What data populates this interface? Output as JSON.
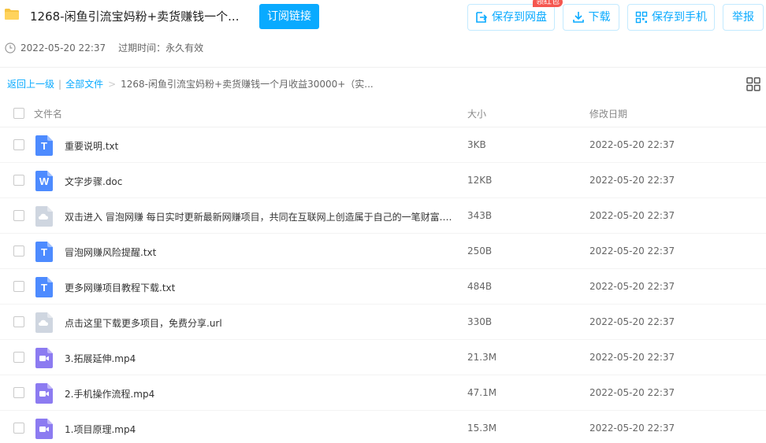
{
  "header": {
    "title": "1268-闲鱼引流宝妈粉+卖货赚钱一个...",
    "subscribe_label": "订阅链接",
    "created": "2022-05-20 22:37",
    "expire": "过期时间：永久有效",
    "folder_icon_color": "#f7c443"
  },
  "toolbar": {
    "save_pan_label": "保存到网盘",
    "badge_label": "领红包",
    "download_label": "下载",
    "save_phone_label": "保存到手机",
    "report_label": "举报",
    "accent_color": "#09aaff",
    "badge_color": "#f5564f"
  },
  "breadcrumb": {
    "back": "返回上一级",
    "all": "全部文件",
    "current": "1268-闲鱼引流宝妈粉+卖货赚钱一个月收益30000+（实..."
  },
  "columns": {
    "name": "文件名",
    "size": "大小",
    "date": "修改日期"
  },
  "files": [
    {
      "name": "重要说明.txt",
      "size": "3KB",
      "date": "2022-05-20 22:37",
      "icon": "txt-file-icon",
      "letter": "T",
      "color": "#4d8bff"
    },
    {
      "name": "文字步骤.doc",
      "size": "12KB",
      "date": "2022-05-20 22:37",
      "icon": "doc-file-icon",
      "letter": "W",
      "color": "#4d8bff"
    },
    {
      "name": "双击进入 冒泡网赚 每日实时更新最新网赚项目，共同在互联网上创造属于自己的一笔财富.url",
      "size": "343B",
      "date": "2022-05-20 22:37",
      "icon": "url-file-icon",
      "letter": "",
      "color": "#cfd6e0"
    },
    {
      "name": "冒泡网赚风险提醒.txt",
      "size": "250B",
      "date": "2022-05-20 22:37",
      "icon": "txt-file-icon",
      "letter": "T",
      "color": "#4d8bff"
    },
    {
      "name": "更多网赚项目教程下载.txt",
      "size": "484B",
      "date": "2022-05-20 22:37",
      "icon": "txt-file-icon",
      "letter": "T",
      "color": "#4d8bff"
    },
    {
      "name": "点击这里下载更多项目，免费分享.url",
      "size": "330B",
      "date": "2022-05-20 22:37",
      "icon": "url-file-icon",
      "letter": "",
      "color": "#cfd6e0"
    },
    {
      "name": "3.拓展延伸.mp4",
      "size": "21.3M",
      "date": "2022-05-20 22:37",
      "icon": "video-file-icon",
      "letter": "",
      "color": "#8c7bf1"
    },
    {
      "name": "2.手机操作流程.mp4",
      "size": "47.1M",
      "date": "2022-05-20 22:37",
      "icon": "video-file-icon",
      "letter": "",
      "color": "#8c7bf1"
    },
    {
      "name": "1.项目原理.mp4",
      "size": "15.3M",
      "date": "2022-05-20 22:37",
      "icon": "video-file-icon",
      "letter": "",
      "color": "#8c7bf1"
    }
  ]
}
